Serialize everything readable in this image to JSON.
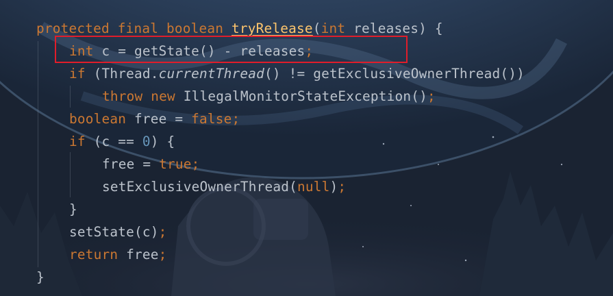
{
  "editor": {
    "lines": [
      {
        "tokens": [
          {
            "t": "protected",
            "c": "kw"
          },
          {
            "t": " ",
            "c": "id"
          },
          {
            "t": "final",
            "c": "kw"
          },
          {
            "t": " ",
            "c": "id"
          },
          {
            "t": "boolean",
            "c": "kw"
          },
          {
            "t": " ",
            "c": "id"
          },
          {
            "t": "tryRelease",
            "c": "fn"
          },
          {
            "t": "(",
            "c": "id"
          },
          {
            "t": "int",
            "c": "kw"
          },
          {
            "t": " releases) {",
            "c": "id"
          }
        ]
      },
      {
        "tokens": [
          {
            "t": "int",
            "c": "kw"
          },
          {
            "t": " c = getState() - releases",
            "c": "id"
          },
          {
            "t": ";",
            "c": "semi"
          }
        ]
      },
      {
        "tokens": [
          {
            "t": "if",
            "c": "kw"
          },
          {
            "t": " (Thread.",
            "c": "id"
          },
          {
            "t": "currentThread",
            "c": "it"
          },
          {
            "t": "() != getExclusiveOwnerThread())",
            "c": "id"
          }
        ]
      },
      {
        "tokens": [
          {
            "t": "throw",
            "c": "kw"
          },
          {
            "t": " ",
            "c": "id"
          },
          {
            "t": "new",
            "c": "kw"
          },
          {
            "t": " IllegalMonitorStateException()",
            "c": "id"
          },
          {
            "t": ";",
            "c": "semi"
          }
        ]
      },
      {
        "tokens": [
          {
            "t": "boolean",
            "c": "kw"
          },
          {
            "t": " free = ",
            "c": "id"
          },
          {
            "t": "false",
            "c": "kw"
          },
          {
            "t": ";",
            "c": "semi"
          }
        ]
      },
      {
        "tokens": [
          {
            "t": "if",
            "c": "kw"
          },
          {
            "t": " (c == ",
            "c": "id"
          },
          {
            "t": "0",
            "c": "num"
          },
          {
            "t": ") {",
            "c": "id"
          }
        ]
      },
      {
        "tokens": [
          {
            "t": "free = ",
            "c": "id"
          },
          {
            "t": "true",
            "c": "kw"
          },
          {
            "t": ";",
            "c": "semi"
          }
        ]
      },
      {
        "tokens": [
          {
            "t": "setExclusiveOwnerThread(",
            "c": "id"
          },
          {
            "t": "null",
            "c": "kw"
          },
          {
            "t": ")",
            "c": "id"
          },
          {
            "t": ";",
            "c": "semi"
          }
        ]
      },
      {
        "tokens": [
          {
            "t": "}",
            "c": "id"
          }
        ]
      },
      {
        "tokens": [
          {
            "t": "setState(c)",
            "c": "id"
          },
          {
            "t": ";",
            "c": "semi"
          }
        ]
      },
      {
        "tokens": [
          {
            "t": "return",
            "c": "kw"
          },
          {
            "t": " free",
            "c": "id"
          },
          {
            "t": ";",
            "c": "semi"
          }
        ]
      },
      {
        "tokens": [
          {
            "t": "}",
            "c": "id"
          }
        ]
      }
    ],
    "highlighted_line": 1,
    "colors": {
      "keyword": "#cc7832",
      "function_declaration": "#ffc66d",
      "identifier": "#bcc3cc",
      "number": "#6897bb",
      "highlight_border": "#e11d2a"
    }
  }
}
